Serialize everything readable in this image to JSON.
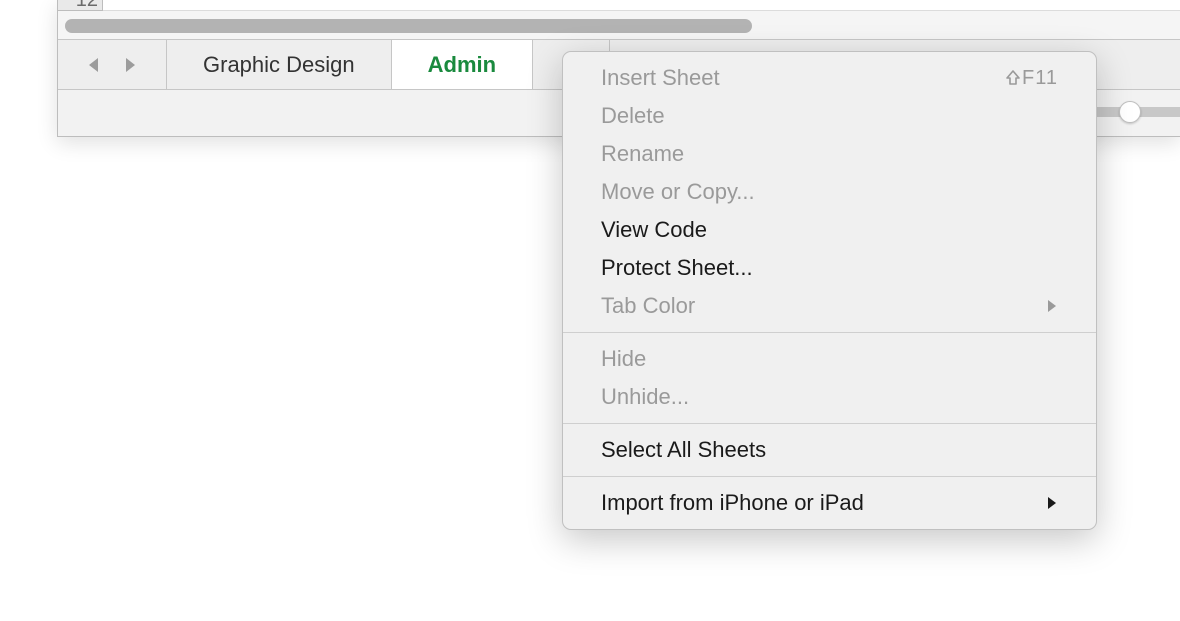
{
  "row": {
    "number": "12"
  },
  "tabs": {
    "graphic_design": "Graphic Design",
    "admin": "Admin"
  },
  "menu": {
    "insert_sheet": "Insert Sheet",
    "insert_sheet_shortcut": "F11",
    "delete": "Delete",
    "rename": "Rename",
    "move_or_copy": "Move or Copy...",
    "view_code": "View Code",
    "protect_sheet": "Protect Sheet...",
    "tab_color": "Tab Color",
    "hide": "Hide",
    "unhide": "Unhide...",
    "select_all_sheets": "Select All Sheets",
    "import_from_iphone": "Import from iPhone or iPad"
  }
}
